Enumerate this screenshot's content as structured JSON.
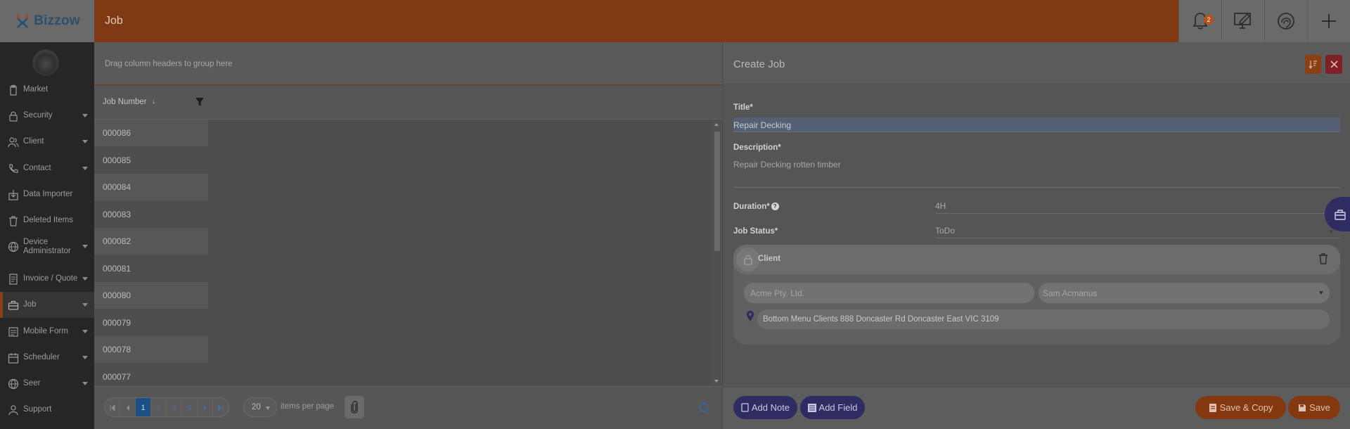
{
  "app": {
    "logo_text": "Bizzow",
    "page_title": "Job",
    "notification_count": "2",
    "colors": {
      "accent": "#7f3a14",
      "primary": "#2f2c61",
      "danger": "#7e2024",
      "pager_active": "#1b4f85"
    }
  },
  "topbar": {
    "icons": [
      "bell-icon",
      "edit-screen-icon",
      "fingerprint-icon",
      "plus-icon"
    ]
  },
  "sidebar": {
    "items": [
      {
        "label": "Market",
        "icon": "clipboard-icon",
        "caret": false
      },
      {
        "label": "Security",
        "icon": "lock-icon",
        "caret": true
      },
      {
        "label": "Client",
        "icon": "users-icon",
        "caret": true
      },
      {
        "label": "Contact",
        "icon": "phone-icon",
        "caret": true
      },
      {
        "label": "Data Importer",
        "icon": "import-icon",
        "caret": false
      },
      {
        "label": "Deleted Items",
        "icon": "trash-icon",
        "caret": false
      },
      {
        "label": "Device Administrator",
        "icon": "globe-icon",
        "caret": true
      },
      {
        "label": "Invoice / Quote",
        "icon": "invoice-icon",
        "caret": true
      },
      {
        "label": "Job",
        "icon": "briefcase-icon",
        "caret": true,
        "active": true
      },
      {
        "label": "Mobile Form",
        "icon": "form-icon",
        "caret": true
      },
      {
        "label": "Scheduler",
        "icon": "calendar-icon",
        "caret": true
      },
      {
        "label": "Seer",
        "icon": "globe-icon",
        "caret": true
      },
      {
        "label": "Support",
        "icon": "support-icon",
        "caret": false
      }
    ]
  },
  "grid": {
    "group_hint": "Drag column headers to group here",
    "column_header": "Job Number",
    "sort_indicator": "↓",
    "rows": [
      "000086",
      "000085",
      "000084",
      "000083",
      "000082",
      "000081",
      "000080",
      "000079",
      "000078",
      "000077"
    ]
  },
  "pager": {
    "pages": [
      "1",
      "2",
      "3",
      "4"
    ],
    "current_page": "1",
    "page_size": "20",
    "per_page_label": "items per page"
  },
  "form": {
    "heading": "Create Job",
    "title_label": "Title*",
    "title_value": "Repair Decking",
    "description_label": "Description*",
    "description_value": "Repair Decking rotten timber",
    "duration_label": "Duration*",
    "duration_value": "4H",
    "status_label": "Job Status*",
    "status_value": "ToDo",
    "client": {
      "heading": "Client",
      "company": "Acme Pty. Ltd.",
      "contact": "Sam Acmanus",
      "address": "Bottom Menu Clients 888 Doncaster Rd Doncaster East VIC 3109"
    },
    "buttons": {
      "add_note": "Add Note",
      "add_field": "Add Field",
      "save_copy": "Save & Copy",
      "save": "Save"
    }
  }
}
